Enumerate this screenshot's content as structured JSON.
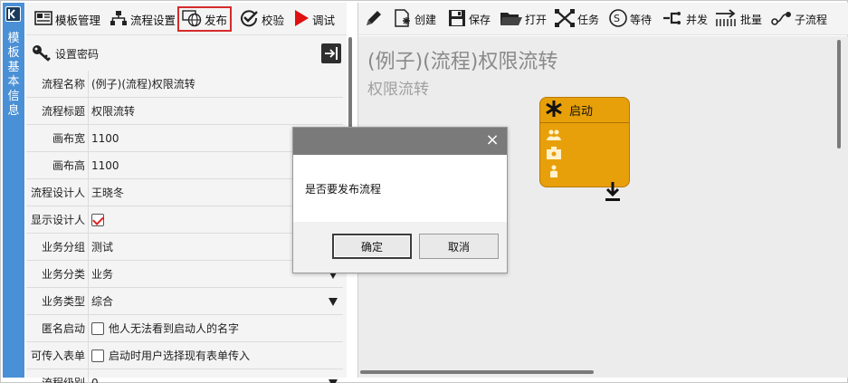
{
  "sidebar": {
    "tab_label": "模板基本信息"
  },
  "toolbar": {
    "template_mgmt": "模板管理",
    "flow_settings": "流程设置",
    "publish": "发布",
    "validate": "校验",
    "debug": "调试"
  },
  "password": {
    "label": "设置密码"
  },
  "properties": [
    {
      "label": "流程名称",
      "value": "(例子)(流程)权限流转"
    },
    {
      "label": "流程标题",
      "value": "权限流转"
    },
    {
      "label": "画布宽",
      "value": "1100"
    },
    {
      "label": "画布高",
      "value": "1100"
    },
    {
      "label": "流程设计人",
      "value": "王晓冬"
    },
    {
      "label": "显示设计人",
      "value": "",
      "checked": true
    },
    {
      "label": "业务分组",
      "value": "测试"
    },
    {
      "label": "业务分类",
      "value": "业务"
    },
    {
      "label": "业务类型",
      "value": "综合"
    },
    {
      "label": "匿名启动",
      "value": "他人无法看到启动人的名字",
      "checked": false
    },
    {
      "label": "可传入表单",
      "value": "启动时用户选择现有表单传入",
      "checked": false
    },
    {
      "label": "流程级别",
      "value": "0"
    }
  ],
  "designer_toolbar": {
    "create": "创建",
    "save": "保存",
    "open": "打开",
    "task": "任务",
    "wait": "等待",
    "parallel": "并发",
    "batch": "批量",
    "subflow": "子流程"
  },
  "canvas": {
    "title": "(例子)(流程)权限流转",
    "subtitle": "权限流转",
    "start_node": "启动"
  },
  "dialog": {
    "message": "是否要发布流程",
    "confirm": "确定",
    "cancel": "取消",
    "close": "×"
  },
  "colors": {
    "sidebar": "#4a90d6",
    "highlight": "#d62b2b",
    "node": "#e8a00a",
    "debug_icon": "#e01010",
    "dialog_header": "#7a7a7a"
  }
}
